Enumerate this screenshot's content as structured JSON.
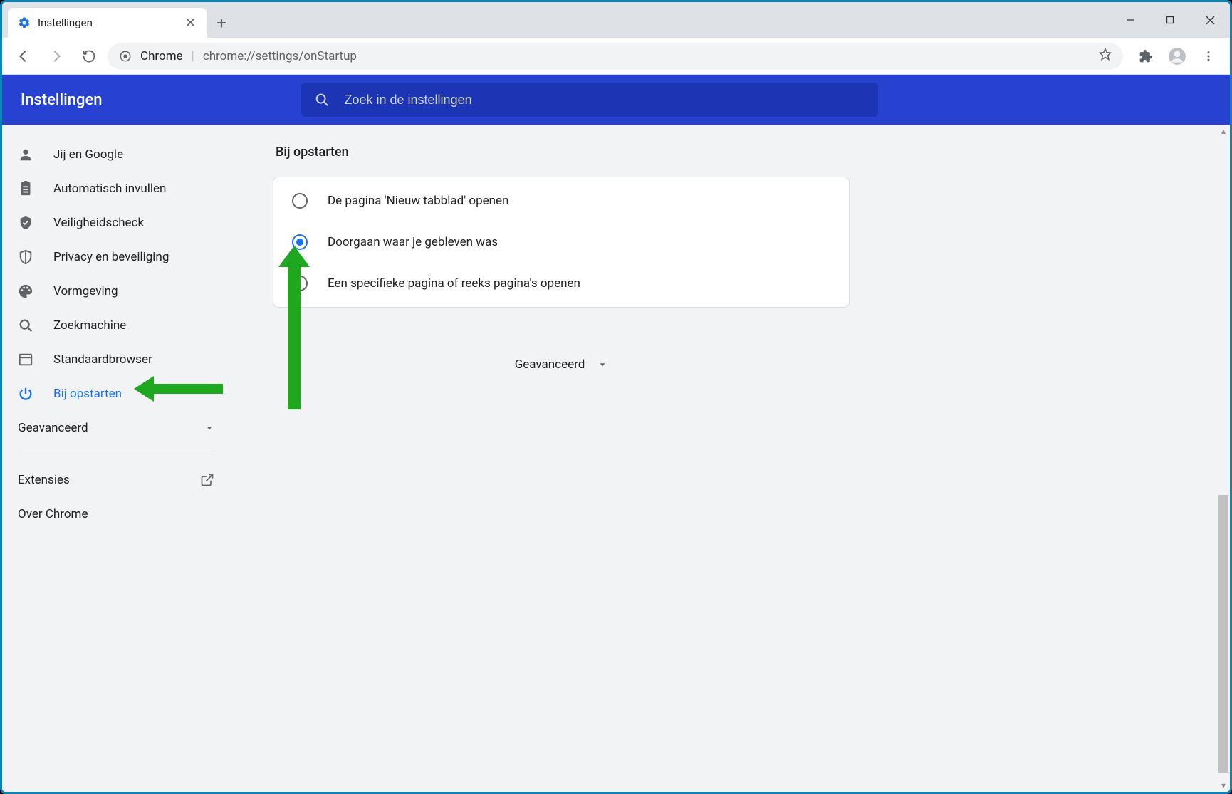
{
  "window": {
    "tab_title": "Instellingen"
  },
  "omnibox": {
    "product": "Chrome",
    "url": "chrome://settings/onStartup"
  },
  "header": {
    "title": "Instellingen",
    "search_placeholder": "Zoek in de instellingen"
  },
  "sidebar": {
    "items": [
      {
        "label": "Jij en Google"
      },
      {
        "label": "Automatisch invullen"
      },
      {
        "label": "Veiligheidscheck"
      },
      {
        "label": "Privacy en beveiliging"
      },
      {
        "label": "Vormgeving"
      },
      {
        "label": "Zoekmachine"
      },
      {
        "label": "Standaardbrowser"
      },
      {
        "label": "Bij opstarten"
      }
    ],
    "advanced_label": "Geavanceerd",
    "extensions_label": "Extensies",
    "about_label": "Over Chrome"
  },
  "main": {
    "section_title": "Bij opstarten",
    "options": [
      {
        "label": "De pagina 'Nieuw tabblad' openen",
        "checked": false
      },
      {
        "label": "Doorgaan waar je gebleven was",
        "checked": true
      },
      {
        "label": "Een specifieke pagina of reeks pagina's openen",
        "checked": false
      }
    ],
    "advanced_label": "Geavanceerd"
  },
  "colors": {
    "accent": "#1a73e8",
    "header": "#2741d1",
    "arrow": "#1fa81f"
  }
}
